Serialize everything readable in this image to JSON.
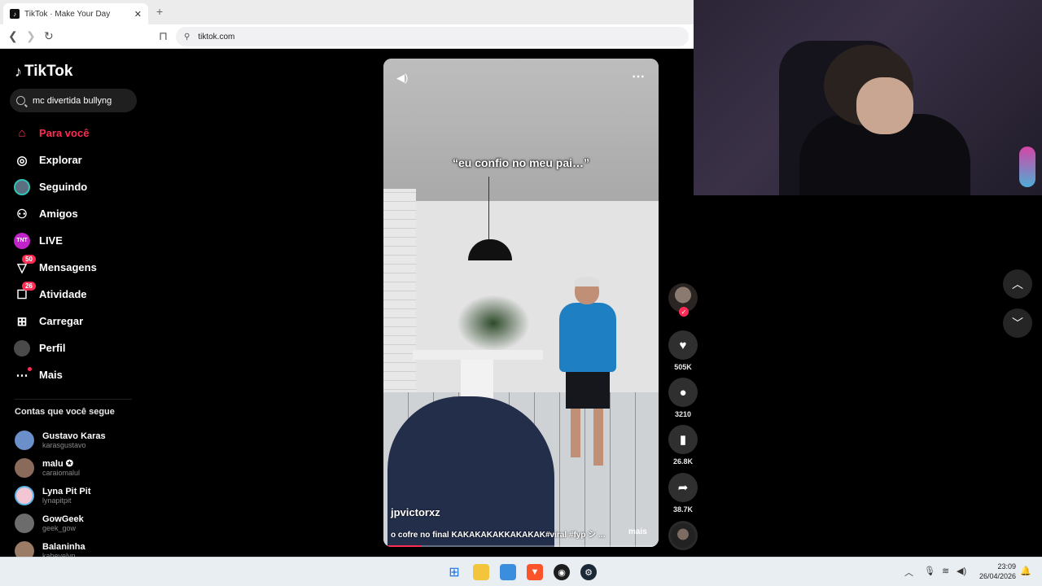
{
  "browser": {
    "tab_title": "TikTok · Make Your Day",
    "url": "tiktok.com"
  },
  "tiktok": {
    "logo_text": "TikTok",
    "search_value": "mc divertida bullyng",
    "menu": [
      {
        "label": "Para você",
        "icon": "home-icon",
        "active": true
      },
      {
        "label": "Explorar",
        "icon": "compass-icon"
      },
      {
        "label": "Seguindo",
        "icon": "following-avatar-icon"
      },
      {
        "label": "Amigos",
        "icon": "friends-icon"
      },
      {
        "label": "LIVE",
        "icon": "live-icon"
      },
      {
        "label": "Mensagens",
        "icon": "messages-icon",
        "badge": "50"
      },
      {
        "label": "Atividade",
        "icon": "activity-icon",
        "badge": "26"
      },
      {
        "label": "Carregar",
        "icon": "upload-icon"
      },
      {
        "label": "Perfil",
        "icon": "profile-icon"
      },
      {
        "label": "Mais",
        "icon": "more-icon"
      }
    ],
    "live_icon_text": "TNT",
    "following_title": "Contas que você segue",
    "following": [
      {
        "name": "Gustavo Karas",
        "user": "karasgustavo",
        "color": "#6b8fc9"
      },
      {
        "name": "malu ✪",
        "user": "caraiomalul",
        "color": "#8a6a5a"
      },
      {
        "name": "Lyna Pit Pit",
        "user": "lynapitpit",
        "color": "#f3c6d4"
      },
      {
        "name": "GowGeek",
        "user": "geek_gow",
        "color": "#6c6c6c"
      },
      {
        "name": "Balaninha",
        "user": "kahevelyn",
        "color": "#9a7b66"
      }
    ]
  },
  "video": {
    "overlay_text": "“eu confio no meu pai…”",
    "author": "jpvictorxz",
    "description": "o cofre no final KAKAKAKAKKAKAKAK#viral #fyp シ ...",
    "more_label": "mais",
    "progress": 0.14
  },
  "actions": {
    "likes": "505K",
    "comments": "3210",
    "saves": "26.8K",
    "shares": "38.7K"
  },
  "taskbar": {
    "time": "23:09",
    "date": "26/04/2026"
  },
  "colors": {
    "accent": "#fe2c55",
    "background": "#000000"
  }
}
